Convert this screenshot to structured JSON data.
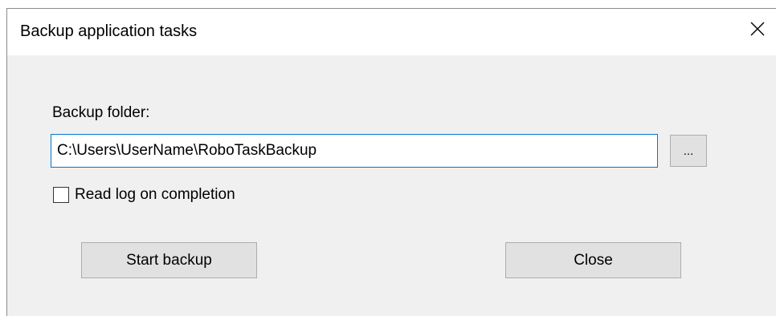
{
  "window": {
    "title": "Backup application tasks",
    "close_icon": "close-icon"
  },
  "form": {
    "folder_label": "Backup folder:",
    "folder_value": "C:\\Users\\UserName\\RoboTaskBackup",
    "browse_label": "...",
    "read_log_label": "Read log on completion",
    "read_log_checked": false
  },
  "buttons": {
    "start_label": "Start backup",
    "close_label": "Close"
  },
  "colors": {
    "focus_border": "#0078d7",
    "dialog_background": "#f0f0f0",
    "button_background": "#e1e1e1"
  }
}
